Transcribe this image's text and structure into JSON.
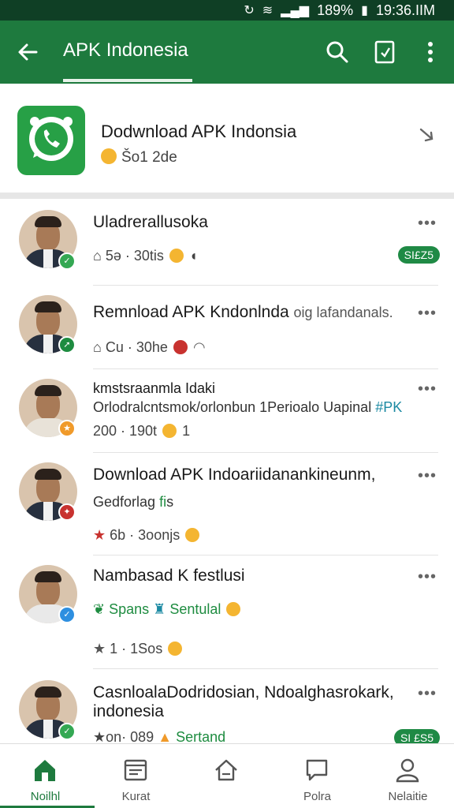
{
  "status_bar": {
    "battery": "189%",
    "time": "19:36.IIM"
  },
  "app_bar": {
    "title": "APK Indonesia"
  },
  "header": {
    "title": "Dodwnload APK Indonsia",
    "subtitle": "Šo1 2de"
  },
  "posts": [
    {
      "name": "Uladrerallusoka",
      "meta": "5ə · 30tis",
      "pill": "SI£Z5"
    },
    {
      "name": "Remnload APK Kndonlnda",
      "name_suffix": "oig lafandanals.",
      "meta": "Cu · 30he"
    },
    {
      "name": "kmstsraanmla Idaki",
      "line": "Orlodralcntsmok/orlonbun 1Perioalo Uapinal",
      "tag": "#PK",
      "meta": "200 · 190t",
      "meta_suffix": "1"
    },
    {
      "name": "Download APK Indoariidanankineunm,",
      "line": "Gedforlag",
      "line_tag": "fi",
      "line_suffix": "s",
      "meta": "6b · 3oonjs"
    },
    {
      "name": "Nambasad K festlusi",
      "line_a": "Spans",
      "line_b": "Sentulal",
      "meta": "1 · 1Sos"
    },
    {
      "name": "CasnloalaDodridosian, Ndoalghasrokark,",
      "name2": "indonesia",
      "meta": "on· 089",
      "meta_b": "Sertand",
      "pill": "SI £S5"
    }
  ],
  "bottom_nav": [
    {
      "label": "Noilhl"
    },
    {
      "label": "Kurat"
    },
    {
      "label": ""
    },
    {
      "label": "Polra"
    },
    {
      "label": "Nelaitie"
    }
  ],
  "colors": {
    "primary": "#1e7a3e",
    "status_bar": "#0f3f25",
    "accent_red": "#c8322f"
  }
}
